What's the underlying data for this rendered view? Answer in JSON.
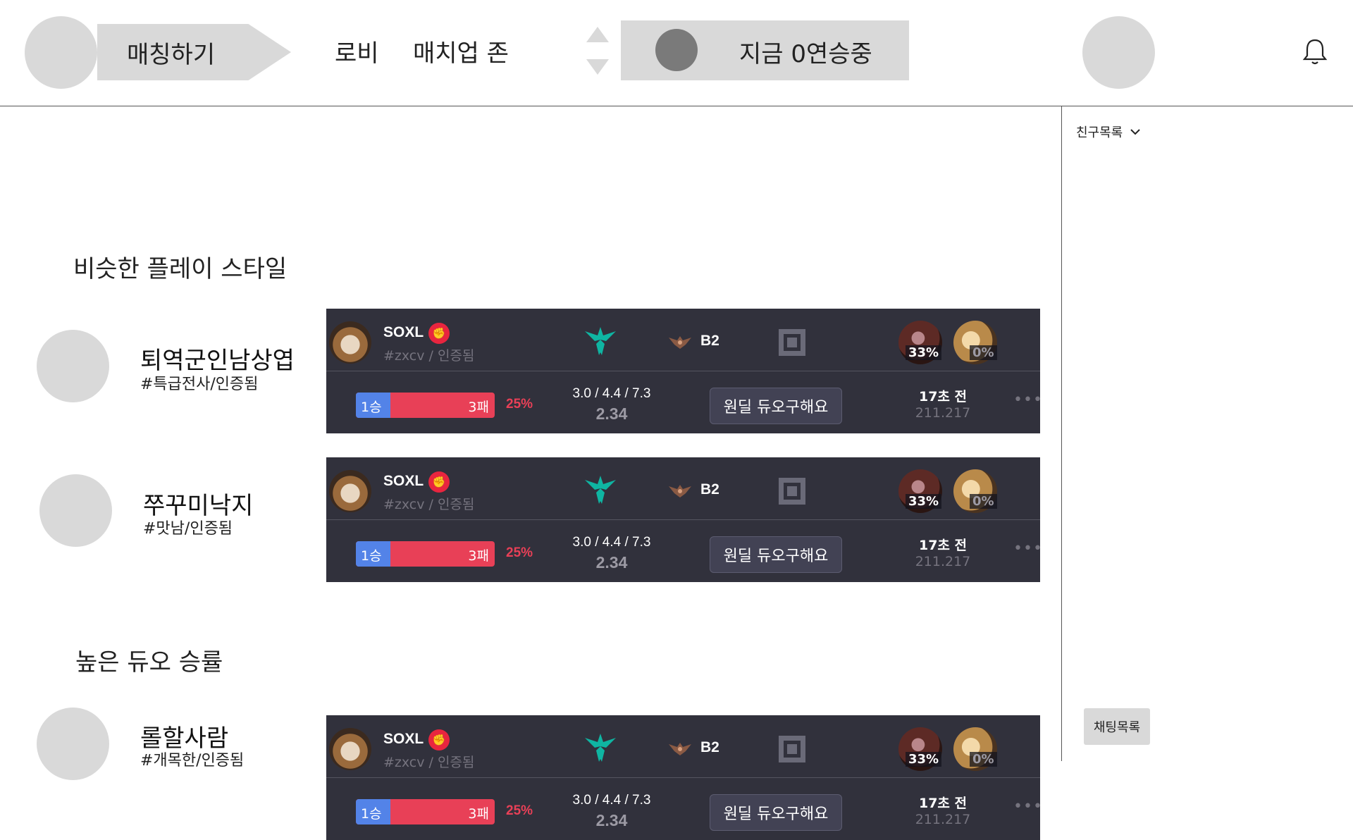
{
  "header": {
    "match_button": "매칭하기",
    "nav": [
      "로비",
      "매치업 존"
    ],
    "streak": "지금 0연승중"
  },
  "sidebar": {
    "friends_label": "친구목록",
    "chat_label": "채팅목록"
  },
  "sections": [
    {
      "title": "비슷한 플레이 스타일",
      "entries": [
        {
          "name": "퇴역군인남상엽",
          "tag": "#특급전사/인증됨"
        },
        {
          "name": "쭈꾸미낙지",
          "tag": "#맛남/인증됨"
        }
      ]
    },
    {
      "title": "높은 듀오 승률",
      "entries": [
        {
          "name": "롤할사람",
          "tag": "#개목한/인증됨"
        }
      ]
    }
  ],
  "card": {
    "player_name": "SOXL",
    "player_tag": "#zxcv / 인증됨",
    "tier": "B2",
    "champ1_rate": "33%",
    "champ2_rate": "0%",
    "wins": "1승",
    "losses": "3패",
    "win_rate": "25%",
    "win_fraction": 0.25,
    "kda": "3.0 / 4.4 / 7.3",
    "kda_ratio": "2.34",
    "memo": "원딜 듀오구해요",
    "time_ago": "17초 전",
    "version": "211.217",
    "more": "•••"
  },
  "colors": {
    "card_bg": "#31313c",
    "win_blue": "#5383e8",
    "loss_red": "#e84057",
    "position_teal": "#0fb5a2"
  }
}
